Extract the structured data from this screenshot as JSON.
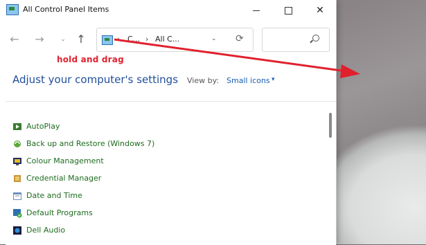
{
  "window": {
    "title": "All Control Panel Items"
  },
  "titlebar_buttons": [
    "minimize",
    "maximize",
    "close"
  ],
  "nav": {
    "back_icon": "←",
    "forward_icon": "→",
    "recent_icon": "⌄",
    "up_icon": "↑"
  },
  "address": {
    "crumbs": [
      "C...",
      "All C..."
    ],
    "separator": "›",
    "dropdown_icon": "⌄",
    "refresh_icon": "⟳"
  },
  "search": {
    "placeholder": ""
  },
  "header": {
    "title": "Adjust your computer's settings",
    "view_by_label": "View by:",
    "view_by_value": "Small icons",
    "caret": "▾"
  },
  "items": [
    {
      "label": "AutoPlay",
      "icon": "autoplay-icon"
    },
    {
      "label": "Back up and Restore (Windows 7)",
      "icon": "backup-icon"
    },
    {
      "label": "Colour Management",
      "icon": "colour-management-icon"
    },
    {
      "label": "Credential Manager",
      "icon": "credential-manager-icon"
    },
    {
      "label": "Date and Time",
      "icon": "date-time-icon"
    },
    {
      "label": "Default Programs",
      "icon": "default-programs-icon"
    },
    {
      "label": "Dell Audio",
      "icon": "dell-audio-icon"
    }
  ],
  "annotation": {
    "text": "hold and drag",
    "color": "#e0212d"
  },
  "colors": {
    "link_green": "#1e6b1e",
    "title_blue": "#1f4e9a",
    "accent_blue": "#1a5fb4"
  }
}
